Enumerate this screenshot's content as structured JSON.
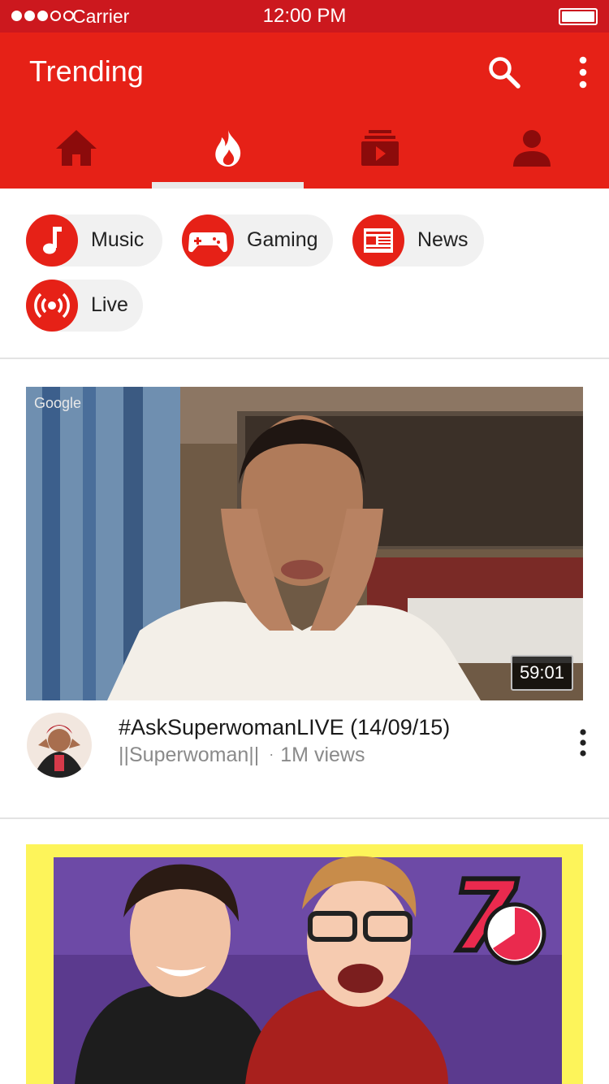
{
  "status_bar": {
    "carrier": "Carrier",
    "time": "12:00 PM",
    "signal_strength": 3,
    "signal_max": 5
  },
  "app_bar": {
    "title": "Trending",
    "search_icon": "search-icon",
    "more_icon": "more-vert-icon",
    "tabs": [
      {
        "icon": "home-icon",
        "selected": false
      },
      {
        "icon": "flame-icon",
        "selected": true
      },
      {
        "icon": "subscriptions-icon",
        "selected": false
      },
      {
        "icon": "account-icon",
        "selected": false
      }
    ]
  },
  "categories": [
    {
      "label": "Music",
      "icon": "music-note-icon"
    },
    {
      "label": "Gaming",
      "icon": "gamepad-icon"
    },
    {
      "label": "News",
      "icon": "newspaper-icon"
    },
    {
      "label": "Live",
      "icon": "live-broadcast-icon"
    }
  ],
  "videos": [
    {
      "title": "#AskSuperwomanLIVE (14/09/15)",
      "channel": "||Superwoman||",
      "separator": "·",
      "views": "1M views",
      "duration": "59:01",
      "watermark": "Google"
    },
    {
      "title": "",
      "channel": "",
      "views": "",
      "badge": "7"
    }
  ],
  "colors": {
    "status_bar": "#cc181e",
    "app_bar": "#e62117",
    "tab_icon_inactive": "#8c0b0b",
    "tab_icon_active": "#ffffff",
    "chip_background": "#f1f1f1",
    "second_thumb_border": "#fdf45a"
  }
}
